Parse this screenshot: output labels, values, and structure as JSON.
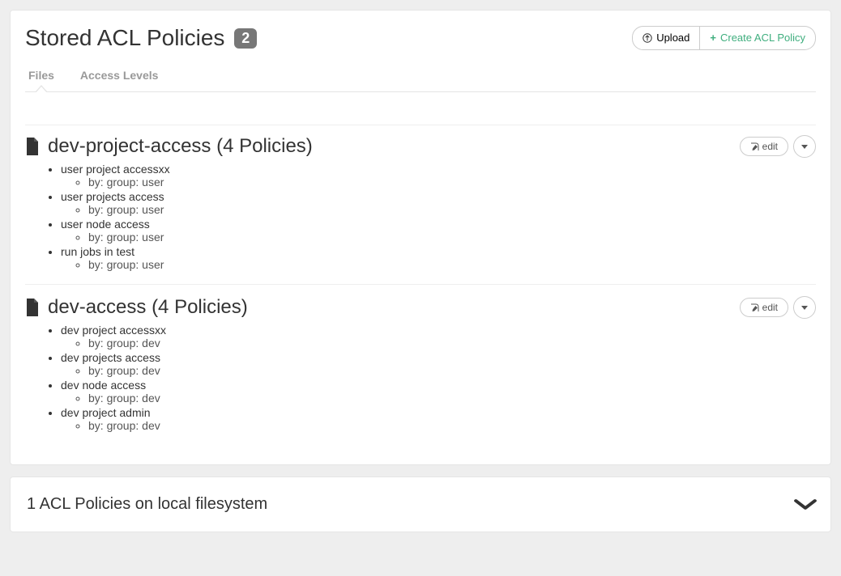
{
  "header": {
    "title": "Stored ACL Policies",
    "count": "2",
    "upload_label": "Upload",
    "create_label": "Create ACL Policy"
  },
  "tabs": [
    {
      "label": "Files",
      "active": true
    },
    {
      "label": "Access Levels",
      "active": false
    }
  ],
  "edit_label": "edit",
  "files": [
    {
      "name": "dev-project-access",
      "policy_count_label": "(4 Policies)",
      "policies": [
        {
          "name": "user project accessxx",
          "by": "by: group: user"
        },
        {
          "name": "user projects access",
          "by": "by: group: user"
        },
        {
          "name": "user node access",
          "by": "by: group: user"
        },
        {
          "name": "run jobs in test",
          "by": "by: group: user"
        }
      ]
    },
    {
      "name": "dev-access",
      "policy_count_label": "(4 Policies)",
      "policies": [
        {
          "name": "dev project accessxx",
          "by": "by: group: dev"
        },
        {
          "name": "dev projects access",
          "by": "by: group: dev"
        },
        {
          "name": "dev node access",
          "by": "by: group: dev"
        },
        {
          "name": "dev project admin",
          "by": "by: group: dev"
        }
      ]
    }
  ],
  "local_fs": {
    "label": "1 ACL Policies on local filesystem"
  }
}
